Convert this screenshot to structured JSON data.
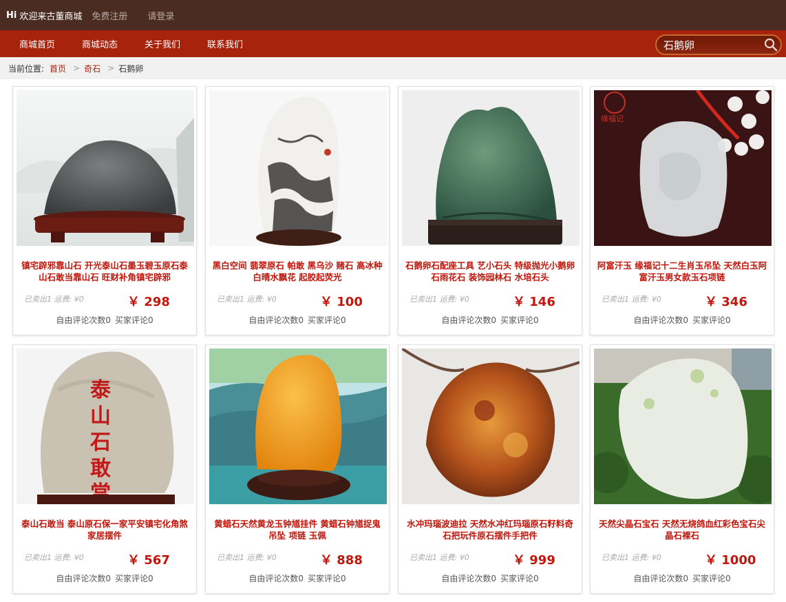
{
  "topbar": {
    "hi": "Hi",
    "welcome": "欢迎来古董商城",
    "register": "免费注册",
    "login": "请登录"
  },
  "nav": {
    "items": [
      "商城首页",
      "商城动态",
      "关于我们",
      "联系我们"
    ]
  },
  "search": {
    "value": "石鹅卵",
    "icon": "search-icon"
  },
  "breadcrumb": {
    "label": "当前位置:",
    "sep": ">",
    "items": [
      "首页",
      "奇石",
      "石鹅卵"
    ]
  },
  "products": [
    {
      "title": "镇宅辟邪靠山石 开光泰山石墨玉碧玉原石泰山石敢当靠山石 旺财补角镇宅辟邪",
      "sold": "已卖出1 运费: ¥0",
      "price": "￥ 298",
      "comment_free": "自由评论次数0",
      "comment_buyer": "买家评论0"
    },
    {
      "title": "黑白空间 翡翠原石 帕敢 黑乌沙 赌石 高冰种 白晴水飘花 起胶起荧光",
      "sold": "已卖出1 运费: ¥0",
      "price": "￥ 100",
      "comment_free": "自由评论次数0",
      "comment_buyer": "买家评论0"
    },
    {
      "title": "石鹅卵石配座工具 艺小石头 特级抛光小鹅卵石雨花石 装饰园林石 水培石头",
      "sold": "已卖出1 运费: ¥0",
      "price": "￥ 146",
      "comment_free": "自由评论次数0",
      "comment_buyer": "买家评论0"
    },
    {
      "title": "阿富汗玉 缘福记十二生肖玉吊坠 天然白玉阿富汗玉男女款玉石项链",
      "sold": "已卖出1 运费: ¥0",
      "price": "￥ 346",
      "comment_free": "自由评论次数0",
      "comment_buyer": "买家评论0",
      "logo_text": "缘福记"
    },
    {
      "title": "泰山石敢当 泰山原石保一家平安镇宅化角煞家居摆件",
      "sold": "已卖出1 运费: ¥0",
      "price": "￥ 567",
      "comment_free": "自由评论次数0",
      "comment_buyer": "买家评论0",
      "stone_text": "泰山石敢當"
    },
    {
      "title": "黄蜡石天然黄龙玉钟馗挂件 黄蜡石钟馗捉鬼吊坠 项链 玉佩",
      "sold": "已卖出1 运费: ¥0",
      "price": "￥ 888",
      "comment_free": "自由评论次数0",
      "comment_buyer": "买家评论0"
    },
    {
      "title": "水冲玛瑙波迪拉 天然水冲红玛瑙原石籽料奇石把玩件原石摆件手把件",
      "sold": "已卖出1 运费: ¥0",
      "price": "￥ 999",
      "comment_free": "自由评论次数0",
      "comment_buyer": "买家评论0"
    },
    {
      "title": "天然尖晶石宝石 天然无烧鸽血红彩色宝石尖晶石裸石",
      "sold": "已卖出1 运费: ¥0",
      "price": "￥ 1000",
      "comment_free": "自由评论次数0",
      "comment_buyer": "买家评论0"
    }
  ],
  "colors": {
    "topbar": "#4a2c23",
    "navbar": "#a8230c",
    "accent": "#c0160b"
  }
}
